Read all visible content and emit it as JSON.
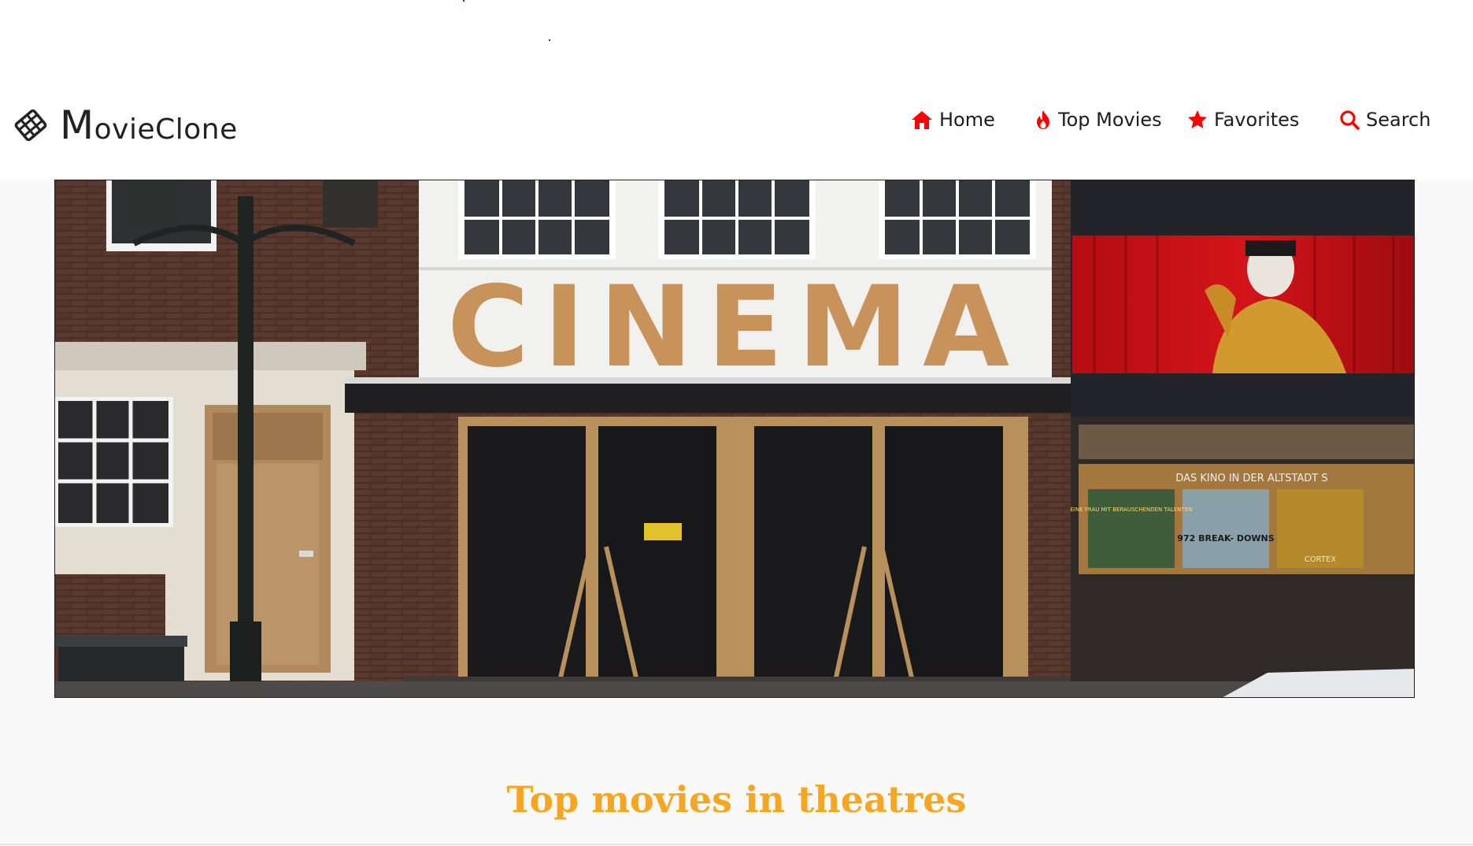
{
  "brand": {
    "name_initial": "M",
    "name_rest": "ovieClone",
    "icon": "film-icon"
  },
  "nav": {
    "home": {
      "label": "Home",
      "icon": "home-icon",
      "color": "#ff0000"
    },
    "top_movies": {
      "label": "Top Movies",
      "icon": "fire-icon",
      "color": "#ff0000"
    },
    "favorites": {
      "label": "Favorites",
      "icon": "star-icon",
      "color": "#ff0000"
    },
    "search": {
      "label": "Search",
      "icon": "search-icon",
      "color": "#ff0000"
    }
  },
  "hero": {
    "sign_text": "CINEMA",
    "posters_banner": "DAS KINO IN DER ALTSTADT S",
    "poster_1": "EINE FRAU MIT BERAUSCHENDEN TALENTEN",
    "poster_2": "972 BREAK- DOWNS",
    "poster_3": "CORTEX"
  },
  "section": {
    "title": "Top movies in theatres",
    "color": "#f5a623"
  }
}
